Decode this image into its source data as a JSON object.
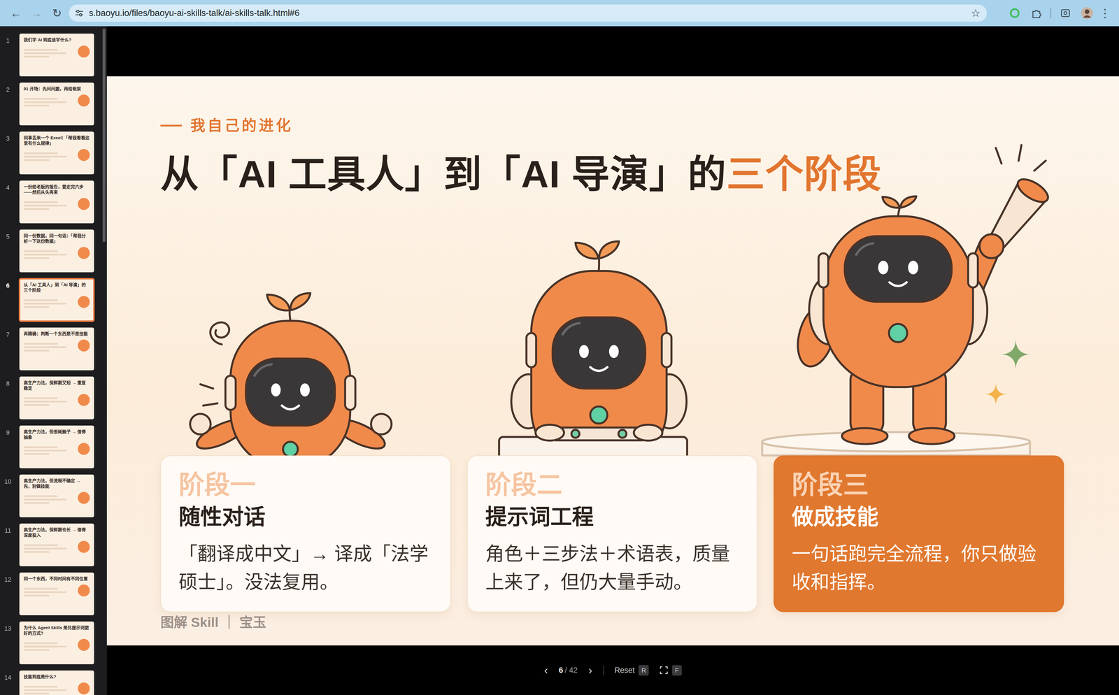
{
  "browser": {
    "nav": [
      {
        "glyph": "←",
        "disabled": false
      },
      {
        "glyph": "→",
        "disabled": true
      },
      {
        "glyph": "↻",
        "disabled": false
      }
    ],
    "url": "s.baoyu.io/files/baoyu-ai-skills-talk/ai-skills-talk.html#6",
    "bookmark": "☆",
    "menu": "⋮"
  },
  "thumbnails": [
    {
      "number": "1",
      "title": "我们学 AI 到底该学什么?",
      "selected": false
    },
    {
      "number": "2",
      "title": "01 开场：先问问题，再给框架",
      "selected": false
    },
    {
      "number": "3",
      "title": "同事丢来一个 Excel：「帮我看看这里有什么规律」",
      "selected": false
    },
    {
      "number": "4",
      "title": "一份给老板的报告，要走完六步——然后从头再来",
      "selected": false
    },
    {
      "number": "5",
      "title": "同一份数据，同一句话：「帮我分析一下这份数据」",
      "selected": false
    },
    {
      "number": "6",
      "title": "从「AI 工具人」到「AI 导演」的三个阶段",
      "selected": true
    },
    {
      "number": "7",
      "title": "再精确：判断一个东西是不是技能",
      "selected": false
    },
    {
      "number": "8",
      "title": "高生产力法，保鲜期又短 → 重复稳定",
      "selected": false
    },
    {
      "number": "9",
      "title": "高生产力法，但很耗脑子 → 值得抽象",
      "selected": false
    },
    {
      "number": "10",
      "title": "高生产力法，但流程不确定 → 先，别做技能",
      "selected": false
    },
    {
      "number": "11",
      "title": "高生产力法，保鲜期也长 → 值得深度投入",
      "selected": false
    },
    {
      "number": "12",
      "title": "同一个东西，不同时间有不同位置",
      "selected": false
    },
    {
      "number": "13",
      "title": "为什么 Agent Skills 是比提示词更好的方式?",
      "selected": false
    },
    {
      "number": "14",
      "title": "技能到底是什么?",
      "selected": false
    }
  ],
  "slide": {
    "kicker": "我自己的进化",
    "title_parts": [
      {
        "text": "从「AI 工具人」到「AI 导演」的",
        "highlight": false
      },
      {
        "text": "三个阶段",
        "highlight": true
      }
    ],
    "stages": [
      {
        "label": "阶段一",
        "name": "随性对话",
        "desc": "「翻译成中文」→ 译成「法学硕士」。没法复用。",
        "selected": false
      },
      {
        "label": "阶段二",
        "name": "提示词工程",
        "desc": "角色＋三步法＋术语表，质量上来了，但仍大量手动。",
        "selected": false
      },
      {
        "label": "阶段三",
        "name": "做成技能",
        "desc": "一句话跑完全流程，你只做验收和指挥。",
        "selected": true
      }
    ],
    "footer": "图解 Skill ｜ 宝玉"
  },
  "controls": {
    "prev": "‹",
    "current": "6",
    "total": "/ 42",
    "next": "›",
    "reset": "Reset",
    "reset_key": "R",
    "fullscreen_key": "F"
  }
}
